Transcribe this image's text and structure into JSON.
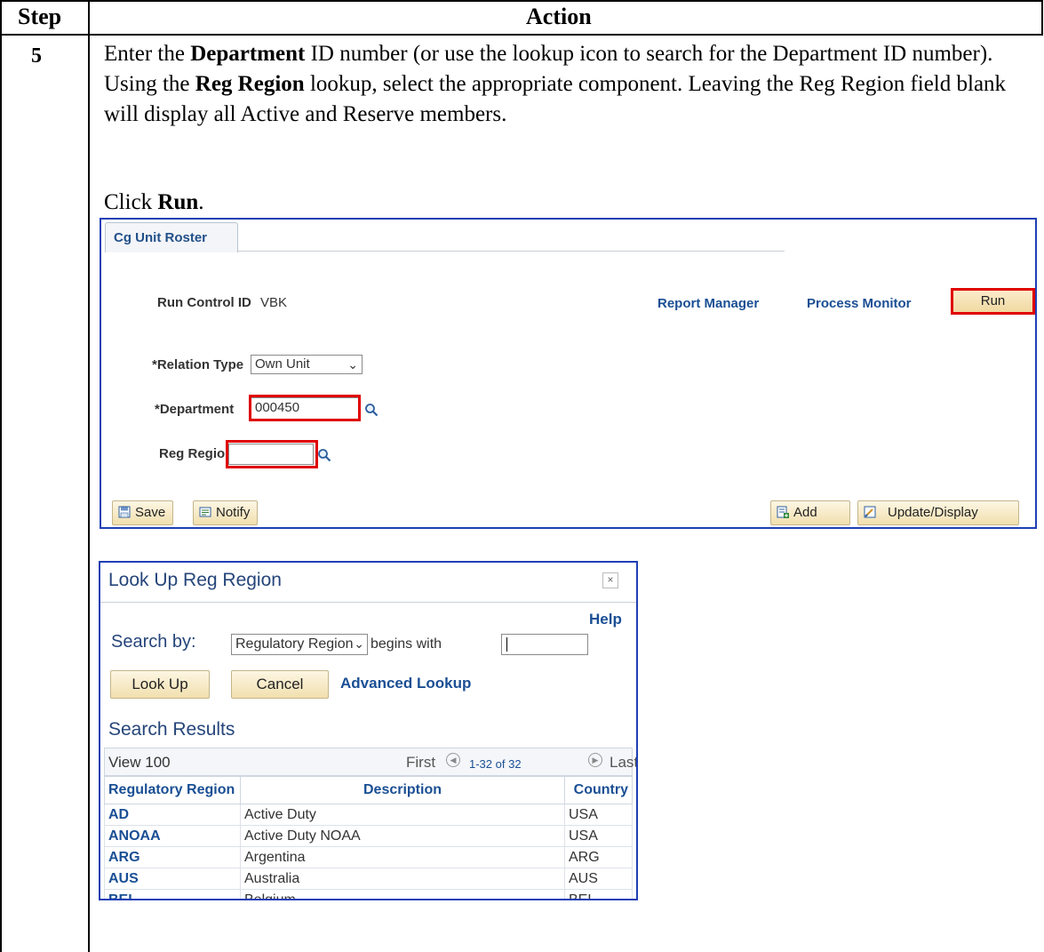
{
  "table": {
    "header_step": "Step",
    "header_action": "Action",
    "step_number": "5"
  },
  "instructions": {
    "p1_a": "Enter the ",
    "p1_b": "Department",
    "p1_c": " ID number (or use the lookup icon to search for the Department ID number). Using the ",
    "p1_d": "Reg Region",
    "p1_e": " lookup, select the appropriate component. Leaving the Reg Region field blank will display all Active and Reserve members.",
    "click_a": "Click ",
    "click_b": "Run",
    "click_c": "."
  },
  "panel": {
    "tab_label": "Cg Unit Roster",
    "run_control_label": "Run Control ID",
    "run_control_value": "VBK",
    "report_manager": "Report Manager",
    "process_monitor": "Process Monitor",
    "run_button": "Run",
    "relation_type_label": "*Relation Type",
    "relation_type_value": "Own Unit",
    "department_label": "*Department",
    "department_value": "000450",
    "reg_region_label": "Reg Region",
    "reg_region_value": "",
    "save_button": "Save",
    "notify_button": "Notify",
    "add_button": "Add",
    "update_display_button": "Update/Display"
  },
  "lookup": {
    "title": "Look Up Reg Region",
    "help": "Help",
    "search_by_label": "Search by:",
    "search_field": "Regulatory Region",
    "operator": "begins with",
    "search_value": "",
    "look_up_button": "Look Up",
    "cancel_button": "Cancel",
    "advanced_lookup": "Advanced Lookup",
    "results_title": "Search Results",
    "view_label": "View 100",
    "first_label": "First",
    "count_label": "1-32 of 32",
    "last_label": "Last",
    "columns": [
      "Regulatory Region",
      "Description",
      "Country"
    ],
    "rows": [
      {
        "code": "AD",
        "description": "Active Duty",
        "country": "USA"
      },
      {
        "code": "ANOAA",
        "description": "Active Duty NOAA",
        "country": "USA"
      },
      {
        "code": "ARG",
        "description": "Argentina",
        "country": "ARG"
      },
      {
        "code": "AUS",
        "description": "Australia",
        "country": "AUS"
      },
      {
        "code": "BEL",
        "description": "Belgium",
        "country": "BEL"
      }
    ]
  },
  "icons": {
    "lookup": "magnifier-icon",
    "close": "close-icon",
    "save": "save-icon",
    "notify": "notify-icon",
    "add": "add-icon",
    "update": "update-icon"
  },
  "colors": {
    "highlight": "#e00000",
    "frame": "#1f3fb5",
    "link": "#1a4f94"
  }
}
